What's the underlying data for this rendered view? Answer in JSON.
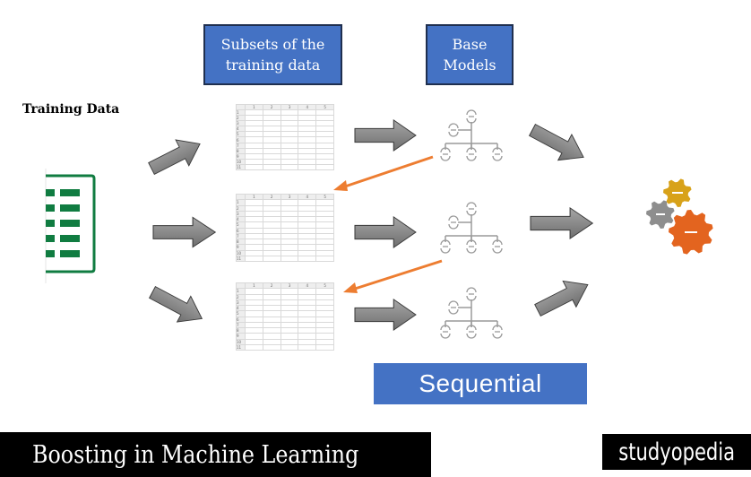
{
  "headers": {
    "subsets_label": "Subsets of the training data",
    "subsets_line1": "Subsets of the",
    "subsets_line2": "training data",
    "base_models_line1": "Base",
    "base_models_line2": "Models"
  },
  "training_data_label": "Training Data",
  "spreadsheet": {
    "columns": [
      "",
      "1",
      "2",
      "3",
      "4",
      "5"
    ],
    "rows": [
      "1",
      "2",
      "3",
      "4",
      "5",
      "6",
      "7",
      "8",
      "9",
      "10",
      "11"
    ]
  },
  "rows": [
    {
      "name": "row-1"
    },
    {
      "name": "row-2"
    },
    {
      "name": "row-3"
    }
  ],
  "sequential_label": "Sequential",
  "footer": {
    "title": "Boosting in Machine Learning",
    "brand": "studyopedia"
  },
  "colors": {
    "accent_blue": "#4472c4",
    "arrow_gray": "#7f7f7f",
    "feedback_orange": "#ed7d31",
    "excel_green": "#107c41",
    "gear_yellow": "#d4a017",
    "gear_gray": "#8c8c8c",
    "gear_orange": "#e0621e"
  }
}
